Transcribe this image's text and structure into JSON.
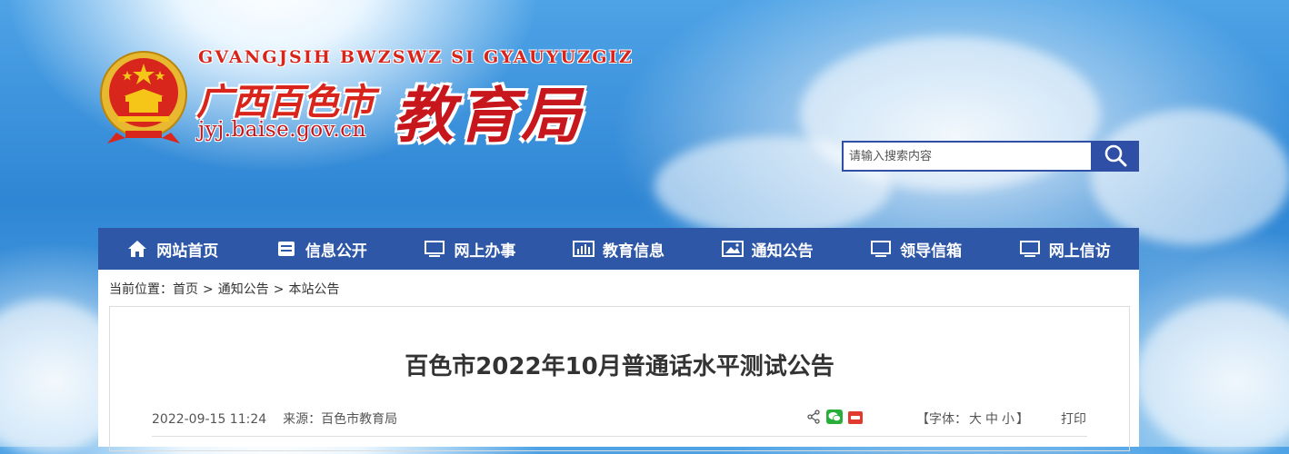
{
  "header": {
    "pinyin": "GVANGJSIH BWZSWZ SI GYAUYUZGIZ",
    "region": "广西百色市",
    "agency": "教育局",
    "domain": "jyj.baise.gov.cn"
  },
  "search": {
    "placeholder": "请输入搜索内容",
    "icon": "search-icon"
  },
  "nav": {
    "items": [
      {
        "label": "网站首页",
        "icon": "home-icon"
      },
      {
        "label": "信息公开",
        "icon": "cabinet-icon"
      },
      {
        "label": "网上办事",
        "icon": "monitor-icon"
      },
      {
        "label": "教育信息",
        "icon": "bar-chart-icon"
      },
      {
        "label": "通知公告",
        "icon": "image-icon"
      },
      {
        "label": "领导信箱",
        "icon": "monitor-icon"
      },
      {
        "label": "网上信访",
        "icon": "monitor-icon"
      }
    ]
  },
  "breadcrumb": {
    "prefix": "当前位置：",
    "items": [
      "首页",
      "通知公告",
      "本站公告"
    ],
    "separator": ">"
  },
  "article": {
    "title": "百色市2022年10月普通话水平测试公告",
    "date": "2022-09-15 11:24",
    "source_label": "来源：",
    "source": "百色市教育局",
    "font_label_open": "【字体：",
    "font_large": "大",
    "font_medium": "中",
    "font_small": "小",
    "font_label_close": "】",
    "print": "打印"
  },
  "colors": {
    "nav_bg": "#2f57a7",
    "search_button": "#2f4fa6",
    "brand_red": "#c8161d"
  }
}
